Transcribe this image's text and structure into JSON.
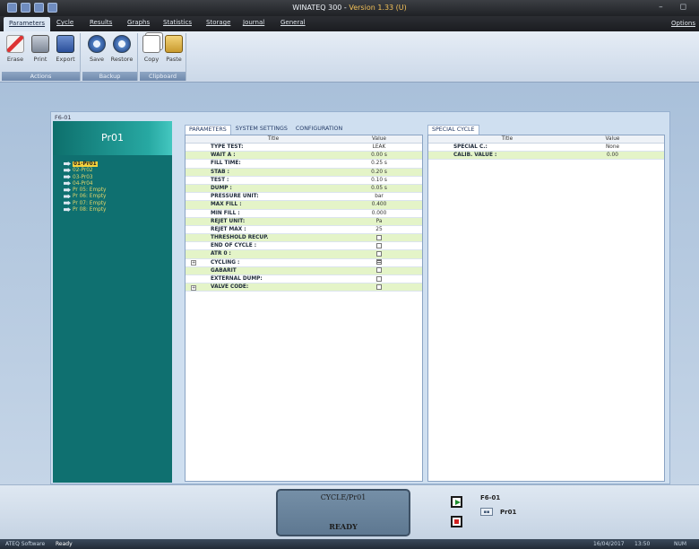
{
  "app": {
    "title": "WINATEQ 300 - ",
    "version": "Version 1.33 (U)"
  },
  "menu": {
    "tabs": [
      "Parameters",
      "Cycle",
      "Results",
      "Graphs",
      "Statistics",
      "Storage",
      "Journal",
      "General"
    ],
    "options": "Options"
  },
  "ribbon": {
    "actions": {
      "label": "Actions",
      "buttons": [
        "Erase",
        "Print",
        "Export"
      ]
    },
    "backup": {
      "label": "Backup",
      "buttons": [
        "Save",
        "Restore"
      ]
    },
    "clipboard": {
      "label": "Clipboard",
      "buttons": [
        "Copy",
        "Paste"
      ]
    }
  },
  "panel": {
    "title": "F6-01",
    "program": "Pr01"
  },
  "tree": [
    "01-Pr01",
    "02-Pr02",
    "03-Pr03",
    "04-Pr04",
    "Pr 05: Empty",
    "Pr 06: Empty",
    "Pr 07: Empty",
    "Pr 08: Empty"
  ],
  "param_tabs": [
    "PARAMETERS",
    "SYSTEM SETTINGS",
    "CONFIGURATION"
  ],
  "columns": {
    "title": "Title",
    "value": "Value"
  },
  "params": [
    {
      "title": "TYPE TEST:",
      "value": "LEAK"
    },
    {
      "title": "WAIT A :",
      "value": "0.00 s"
    },
    {
      "title": "FILL TIME:",
      "value": "0.25 s"
    },
    {
      "title": "STAB :",
      "value": "0.20 s"
    },
    {
      "title": "TEST :",
      "value": "0.10 s"
    },
    {
      "title": "DUMP :",
      "value": "0.05 s"
    },
    {
      "title": "PRESSURE UNIT:",
      "value": "bar"
    },
    {
      "title": "MAX FILL :",
      "value": "0.400"
    },
    {
      "title": "MIN FILL :",
      "value": "0.000"
    },
    {
      "title": "REJET UNIT:",
      "value": "Pa"
    },
    {
      "title": "REJET MAX :",
      "value": "25"
    },
    {
      "title": "THRESHOLD RECUP.",
      "value": "",
      "checkbox": true,
      "checked": false
    },
    {
      "title": "END OF CYCLE :",
      "value": "",
      "checkbox": true,
      "checked": false
    },
    {
      "title": "ATR 0 :",
      "value": "",
      "checkbox": true,
      "checked": false
    },
    {
      "title": "CYCLING :",
      "value": "",
      "checkbox": true,
      "checked": true,
      "expander": true
    },
    {
      "title": "GABARIT",
      "value": "",
      "checkbox": true,
      "checked": false
    },
    {
      "title": "EXTERNAL DUMP:",
      "value": "",
      "checkbox": true,
      "checked": false
    },
    {
      "title": "VALVE CODE:",
      "value": "",
      "checkbox": true,
      "checked": false,
      "expander": true
    }
  ],
  "special_tab": "SPECIAL CYCLE",
  "special": [
    {
      "title": "SPECIAL C.:",
      "value": "None"
    },
    {
      "title": "CALIB. VALUE :",
      "value": "0.00"
    }
  ],
  "display": {
    "line1": "CYCLE/Pr01",
    "line2": "READY"
  },
  "bottom": {
    "station": "F6-01",
    "program": "Pr01"
  },
  "status": {
    "left": "ATEQ Software",
    "state": "Ready",
    "date": "16/04/2017",
    "time": "13:50",
    "num": "NUM"
  }
}
